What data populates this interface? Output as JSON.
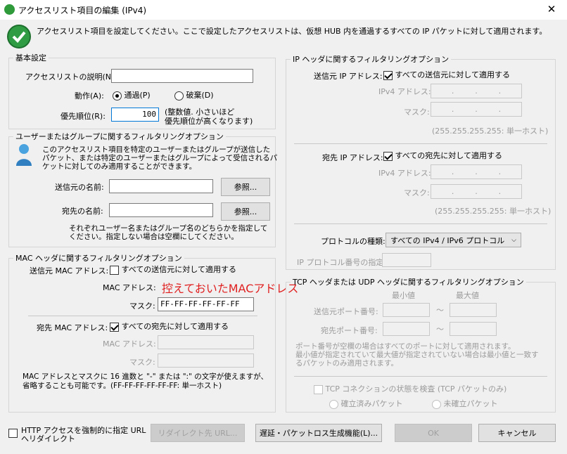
{
  "window": {
    "title": "アクセスリスト項目の編集 (IPv4)",
    "close": "✕"
  },
  "intro": "アクセスリスト項目を設定してください。ここで設定したアクセスリストは、仮想 HUB 内を通過するすべての IP パケットに対して適用されます。",
  "basic": {
    "legend": "基本設定",
    "desc_label": "アクセスリストの説明(N):",
    "desc_value": "",
    "action_label": "動作(A):",
    "pass_label": "通過(P)",
    "discard_label": "破棄(D)",
    "priority_label": "優先順位(R):",
    "priority_value": "100",
    "priority_note_1": "(整数値. 小さいほど",
    "priority_note_2": "優先順位が高くなります)"
  },
  "user": {
    "legend": "ユーザーまたはグループに関するフィルタリングオプション",
    "desc_1": "このアクセスリスト項目を特定のユーザーまたはグループが送信した",
    "desc_2": "パケット、または特定のユーザーまたはグループによって受信されるパ",
    "desc_3": "ケットに対してのみ適用することができます。",
    "src_label": "送信元の名前:",
    "dst_label": "宛先の名前:",
    "browse": "参照...",
    "note_1": "それぞれユーザー名またはグループ名のどちらかを指定して",
    "note_2": "ください。指定しない場合は空欄にしてください。"
  },
  "mac": {
    "legend": "MAC ヘッダに関するフィルタリングオプション",
    "src_label": "送信元 MAC アドレス:",
    "src_all": "すべての送信元に対して適用する",
    "mac_label": "MAC アドレス:",
    "mask_label": "マスク:",
    "src_mask_value": "FF-FF-FF-FF-FF-FF",
    "dst_label": "宛先 MAC アドレス:",
    "dst_all": "すべての宛先に対して適用する",
    "note_1": "MAC アドレスとマスクに 16 進数と \"-\" または \":\" の文字が使えますが、",
    "note_2": "省略することも可能です。(FF-FF-FF-FF-FF-FF: 単一ホスト)"
  },
  "annotation": "控えておいたMACアドレス",
  "ip": {
    "legend": "IP ヘッダに関するフィルタリングオプション",
    "src_label": "送信元 IP アドレス:",
    "src_all": "すべての送信元に対して適用する",
    "ipv4_label": "IPv4 アドレス:",
    "mask_label": "マスク:",
    "single_host": "(255.255.255.255: 単一ホスト)",
    "dst_label": "宛先 IP アドレス:",
    "dst_all": "すべての宛先に対して適用する",
    "dot": ".",
    "protocol_label": "プロトコルの種類:",
    "protocol_value": "すべての IPv4 / IPv6 プロトコル",
    "protocol_num_label": "IP プロトコル番号の指定:"
  },
  "tcp": {
    "legend": "TCP ヘッダまたは UDP ヘッダに関するフィルタリングオプション",
    "min": "最小値",
    "max": "最大値",
    "src_port": "送信元ポート番号:",
    "dst_port": "宛先ポート番号:",
    "tilde": "～",
    "note_1": "ポート番号が空欄の場合はすべてのポートに対して適用されます。",
    "note_2": "最小値が指定されていて最大値が指定されていない場合は最小値と一致す",
    "note_3": "るパケットのみ適用されます。",
    "state_check": "TCP コネクションの状態を検査 (TCP パケットのみ)",
    "established": "確立済みパケット",
    "unestablished": "未確立パケット"
  },
  "footer": {
    "http_1": "HTTP アクセスを強制的に指定 URL",
    "http_2": "へリダイレクト",
    "redirect": "リダイレクト先 URL...",
    "delay": "遅延・パケットロス生成機能(L)...",
    "ok": "OK",
    "cancel": "キャンセル"
  }
}
